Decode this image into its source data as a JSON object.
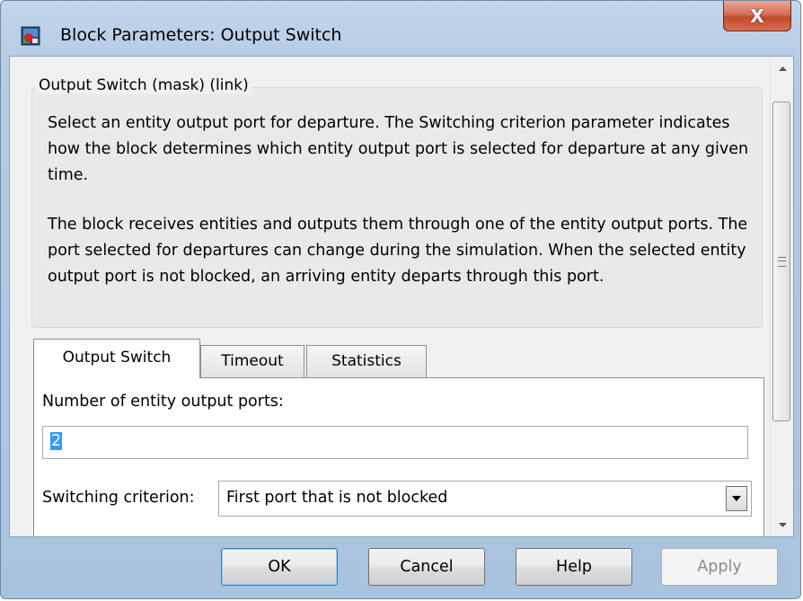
{
  "window": {
    "title": "Block Parameters: Output Switch",
    "close_glyph": "X"
  },
  "mask": {
    "legend": "Output Switch (mask) (link)",
    "description_1": "Select an entity output port for departure. The Switching criterion parameter indicates how the block determines which entity output port is selected for departure at any given time.",
    "description_2": "The block receives entities and outputs them through one of the entity output ports. The port selected for departures can change during the simulation. When the selected entity output port is not blocked, an arriving entity departs through this port."
  },
  "tabs": [
    {
      "label": "Output Switch",
      "active": true
    },
    {
      "label": "Timeout",
      "active": false
    },
    {
      "label": "Statistics",
      "active": false
    }
  ],
  "params": {
    "ports_label": "Number of entity output ports:",
    "ports_value": "2",
    "criterion_label": "Switching criterion:",
    "criterion_value": "First port that is not blocked"
  },
  "buttons": {
    "ok": "OK",
    "cancel": "Cancel",
    "help": "Help",
    "apply": "Apply"
  },
  "icons": {
    "app": "simulink-block-icon",
    "close": "close-icon",
    "dropdown": "chevron-down-icon",
    "scroll_up": "scroll-up-icon",
    "scroll_down": "scroll-down-icon"
  },
  "colors": {
    "titlebar": "#b4cbe4",
    "close_button": "#c9573c",
    "selection": "#3399ff"
  }
}
